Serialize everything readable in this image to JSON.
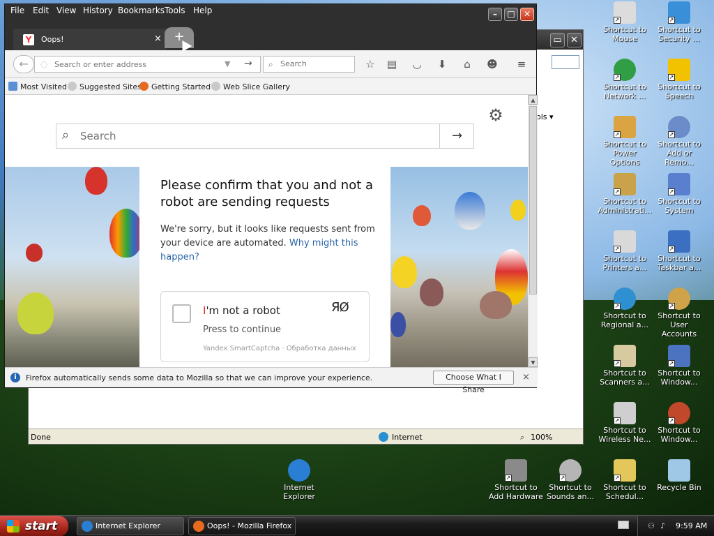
{
  "firefox": {
    "menu": [
      "File",
      "Edit",
      "View",
      "History",
      "Bookmarks",
      "Tools",
      "Help"
    ],
    "tab": {
      "title": "Oops!",
      "close": "×",
      "new_tab": "+"
    },
    "urlbar": {
      "placeholder": "Search or enter address",
      "go": "→"
    },
    "searchbar": {
      "placeholder": "Search"
    },
    "bookmarks": [
      "Most Visited",
      "Suggested Sites",
      "Getting Started",
      "Web Slice Gallery"
    ],
    "notification": {
      "message": "Firefox automatically sends some data to Mozilla so that we can improve your experience.",
      "button": "Choose What I Share",
      "close": "×"
    }
  },
  "page": {
    "search_placeholder": "Search",
    "title": "Please confirm that you and not a robot are sending requests",
    "desc_text": "We're sorry, but it looks like requests sent from your device are automated.",
    "desc_link": "Why might this happen?",
    "captcha": {
      "label_first": "I",
      "label_rest": "'m not a robot",
      "press": "Press to continue",
      "footer": "Yandex SmartCaptcha · Обработка данных",
      "logo": "ЯØ"
    }
  },
  "ie": {
    "status_left": "Done",
    "status_zone": "Internet",
    "zoom": "100%",
    "tools": "ols ▾"
  },
  "desktop_icons": [
    {
      "label": "Shortcut to Mouse",
      "color": "#dcdcdc"
    },
    {
      "label": "Shortcut to Security ...",
      "color": "#3a8fd9"
    },
    {
      "label": "Shortcut to Network ...",
      "color": "#2f9e44"
    },
    {
      "label": "Shortcut to Speech",
      "color": "#f2c200"
    },
    {
      "label": "Shortcut to Power Options",
      "color": "#d9a441"
    },
    {
      "label": "Shortcut to Add or Remo...",
      "color": "#6b8bc9"
    },
    {
      "label": "Shortcut to Administrati...",
      "color": "#caa24a"
    },
    {
      "label": "Shortcut to System",
      "color": "#5b7fcf"
    },
    {
      "label": "Shortcut to Printers a...",
      "color": "#d9d9d9"
    },
    {
      "label": "Shortcut to Taskbar a...",
      "color": "#3b6fc2"
    },
    {
      "label": "Shortcut to Regional a...",
      "color": "#2e8fd1"
    },
    {
      "label": "Shortcut to User Accounts",
      "color": "#d0a24a"
    },
    {
      "label": "Shortcut to Scanners a...",
      "color": "#d7c9a0"
    },
    {
      "label": "Shortcut to Window...",
      "color": "#4b73c0"
    },
    {
      "label": "Shortcut to Wireless Ne...",
      "color": "#cfcfcf"
    },
    {
      "label": "Shortcut to Window...",
      "color": "#c2482c"
    },
    {
      "label": "Shortcut to Add Hardware",
      "color": "#8a8a8a"
    },
    {
      "label": "Shortcut to Sounds an...",
      "color": "#b5b5b5"
    },
    {
      "label": "Shortcut to Schedul...",
      "color": "#e3c75a"
    },
    {
      "label": "Recycle Bin",
      "color": "#9fc8e6"
    },
    {
      "label": "Internet Explorer",
      "color": "#2a7fd4"
    }
  ],
  "taskbar": {
    "start": "start",
    "tasks": [
      "Internet Explorer can...",
      "Oops! - Mozilla Firefox"
    ],
    "clock": "9:59 AM"
  }
}
